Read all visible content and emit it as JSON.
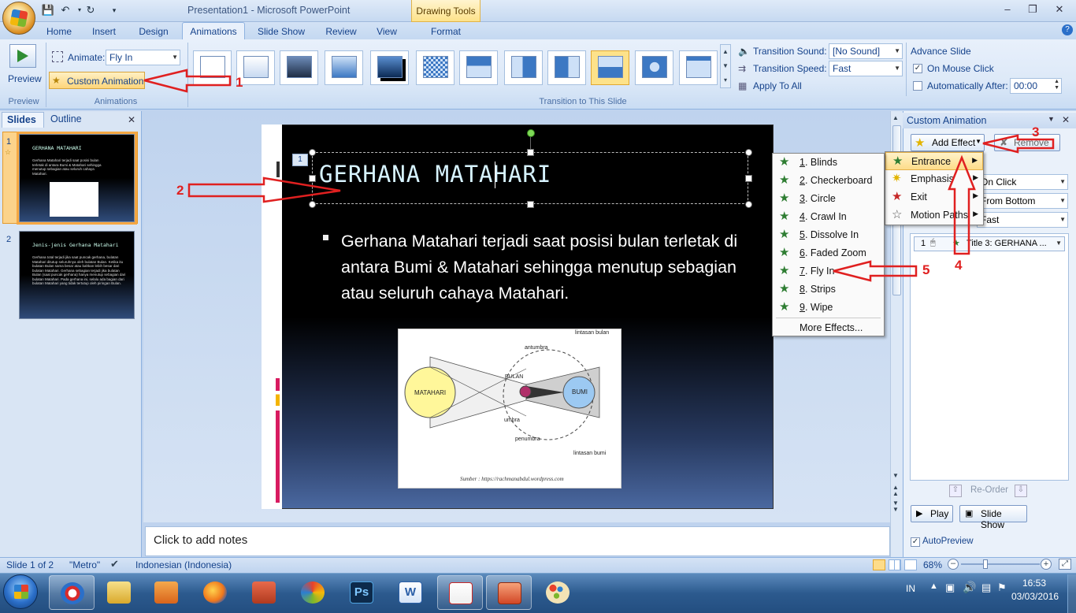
{
  "window": {
    "title": "Presentation1 - Microsoft PowerPoint",
    "contextual_tab": "Drawing Tools"
  },
  "ribbon_tabs": [
    "Home",
    "Insert",
    "Design",
    "Animations",
    "Slide Show",
    "Review",
    "View",
    "Format"
  ],
  "ribbon": {
    "preview_label": "Preview",
    "preview_group": "Preview",
    "animate_label": "Animate:",
    "animate_value": "Fly In",
    "custom_animation_label": "Custom Animation",
    "animations_group": "Animations",
    "transition_group": "Transition to This Slide",
    "transition_sound_label": "Transition Sound:",
    "transition_sound_value": "[No Sound]",
    "transition_speed_label": "Transition Speed:",
    "transition_speed_value": "Fast",
    "apply_to_all": "Apply To All",
    "advance_slide": "Advance Slide",
    "on_mouse_click": "On Mouse Click",
    "on_mouse_click_checked": true,
    "automatically_after": "Automatically After:",
    "automatically_after_checked": false,
    "auto_time": "00:00"
  },
  "left_pane": {
    "tab_slides": "Slides",
    "tab_outline": "Outline",
    "slides": [
      {
        "number": "1",
        "title": "GERHANA MATAHARI",
        "body": "Gerhana Matahari terjadi saat posisi bulan terletak di antara Bumi & Matahari sehingga menutup sebagian atau seluruh cahaya Matahari."
      },
      {
        "number": "2",
        "title": "Jenis-jenis Gerhana Matahari",
        "body": "Gerhana total terjadi jika saat puncak gerhana, bulatan Matahari ditutup seluruhnya oleh bulatan Bulan. Ketika itu bulatan Bulan sama besar atau bahkan lebih besar dari bulatan Matahari. Gerhana sebagian terjadi jika bulatan Bulan (saat puncak gerhana) hanya menutup sebagian dari bulatan Matahari. Pada gerhana ini, selalu ada bagian dari bulatan Matahari yang tidak tertutup oleh piringan Bulan."
      }
    ]
  },
  "slide": {
    "anim_tag": "1",
    "title": "GERHANA MATAHARI",
    "bullet": "Gerhana Matahari terjadi saat posisi bulan terletak di antara Bumi & Matahari sehingga menutup sebagian atau seluruh cahaya Matahari.",
    "diagram": {
      "matahari": "MATAHARI",
      "bulan": "BULAN",
      "bumi": "BUMI",
      "antumbra": "antumbra",
      "lintasan_bulan": "lintasan bulan",
      "umbra": "umbra",
      "penumbra": "penumbra",
      "lintasan_bumi": "lintasan bumi",
      "source": "Sumber : https://rachmanabdul.wordpress.com"
    }
  },
  "notes_placeholder": "Click to add notes",
  "task_pane": {
    "title": "Custom Animation",
    "add_effect": "Add Effect",
    "remove": "Remove",
    "start_value": "On Click",
    "direction_value": "From Bottom",
    "speed_value": "Fast",
    "list_item_number": "1",
    "list_item_label": "Title 3: GERHANA ...",
    "reorder": "Re-Order",
    "play": "Play",
    "slide_show": "Slide Show",
    "autopreview": "AutoPreview",
    "autopreview_checked": true
  },
  "add_effect_menu": [
    "Entrance",
    "Emphasis",
    "Exit",
    "Motion Paths"
  ],
  "entrance_submenu": [
    {
      "key": "1",
      "label": "Blinds"
    },
    {
      "key": "2",
      "label": "Checkerboard"
    },
    {
      "key": "3",
      "label": "Circle"
    },
    {
      "key": "4",
      "label": "Crawl In"
    },
    {
      "key": "5",
      "label": "Dissolve In"
    },
    {
      "key": "6",
      "label": "Faded Zoom"
    },
    {
      "key": "7",
      "label": "Fly In"
    },
    {
      "key": "8",
      "label": "Strips"
    },
    {
      "key": "9",
      "label": "Wipe"
    }
  ],
  "more_effects": "More Effects...",
  "status_bar": {
    "slide_of": "Slide 1 of 2",
    "theme": "\"Metro\"",
    "language": "Indonesian (Indonesia)",
    "zoom": "68%"
  },
  "annotations": [
    "1",
    "2",
    "3",
    "4",
    "5"
  ],
  "taskbar": {
    "lang": "IN",
    "time": "16:53",
    "date": "03/03/2016"
  },
  "colors": {
    "ribbon_bg": "#dde9f8",
    "accent_orange": "#fddc8a",
    "annotation_red": "#e02020",
    "slide_title": "#d7f3ff"
  }
}
